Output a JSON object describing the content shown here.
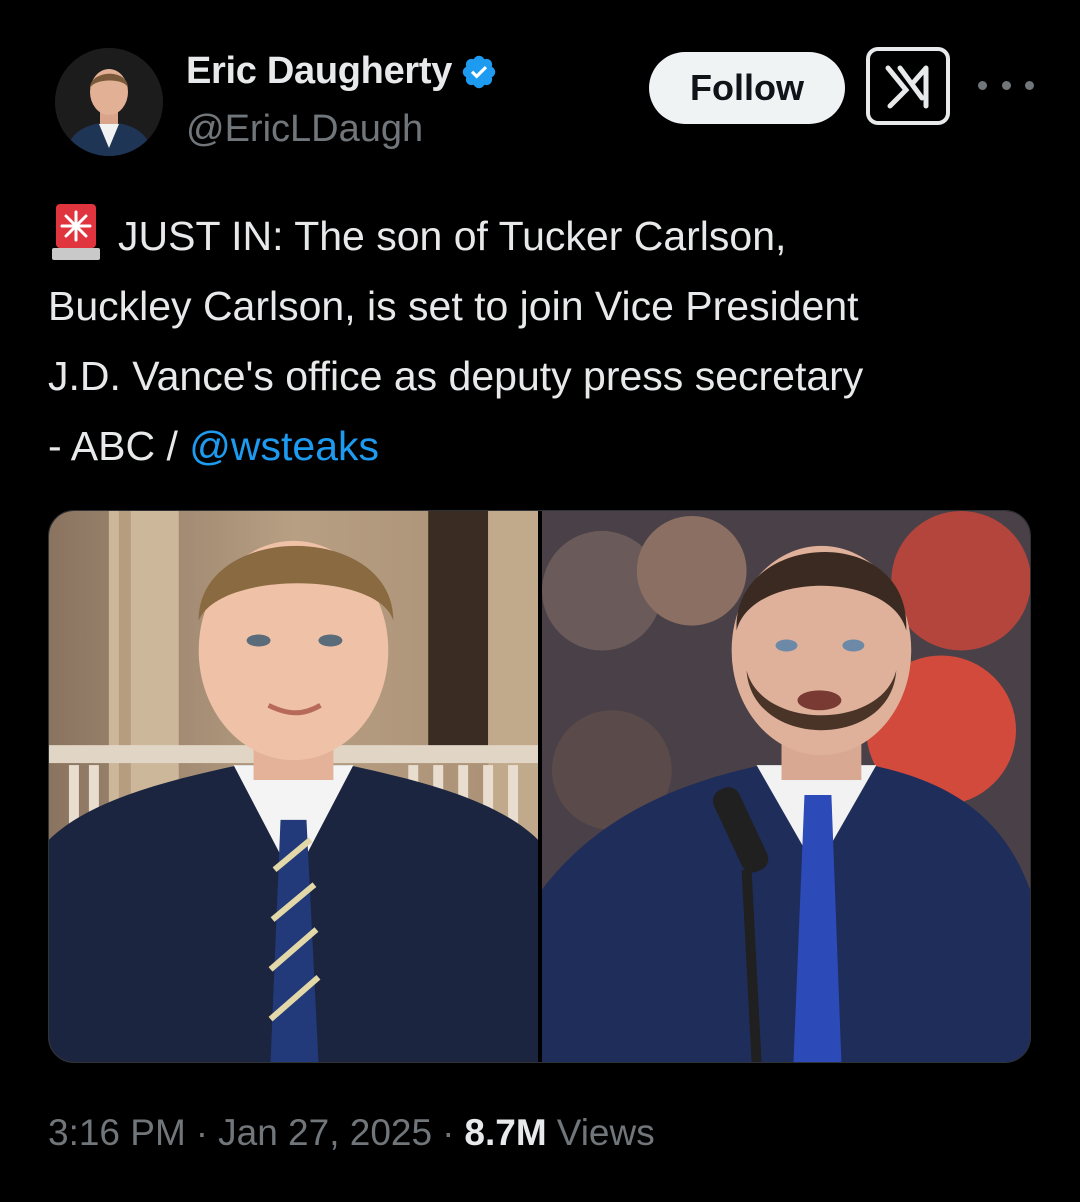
{
  "author": {
    "display_name": "Eric Daugherty",
    "handle": "@EricLDaugh",
    "verified": true,
    "avatar_icon": "profile-photo"
  },
  "actions": {
    "follow_label": "Follow",
    "grok_icon": "grok-icon",
    "more_icon": "more-icon"
  },
  "tweet": {
    "emoji_icon": "rotating-light-icon",
    "line1": "JUST IN: The son of Tucker Carlson,",
    "line2": "Buckley Carlson, is set to join Vice President",
    "line3": "J.D. Vance's office as deputy press secretary",
    "line4_prefix": "- ABC / ",
    "mention": "@wsteaks"
  },
  "media": {
    "images": [
      "photo-young-man-in-suit",
      "photo-man-speaking-at-microphone"
    ]
  },
  "meta": {
    "time": "3:16 PM",
    "separator": "·",
    "date": "Jan 27, 2025",
    "views_count": "8.7M",
    "views_label": "Views"
  },
  "colors": {
    "background": "#000000",
    "text": "#e7e9ea",
    "secondary": "#71767b",
    "link": "#1d9bf0",
    "verified": "#1d9bf0",
    "follow_bg": "#eff3f4"
  }
}
